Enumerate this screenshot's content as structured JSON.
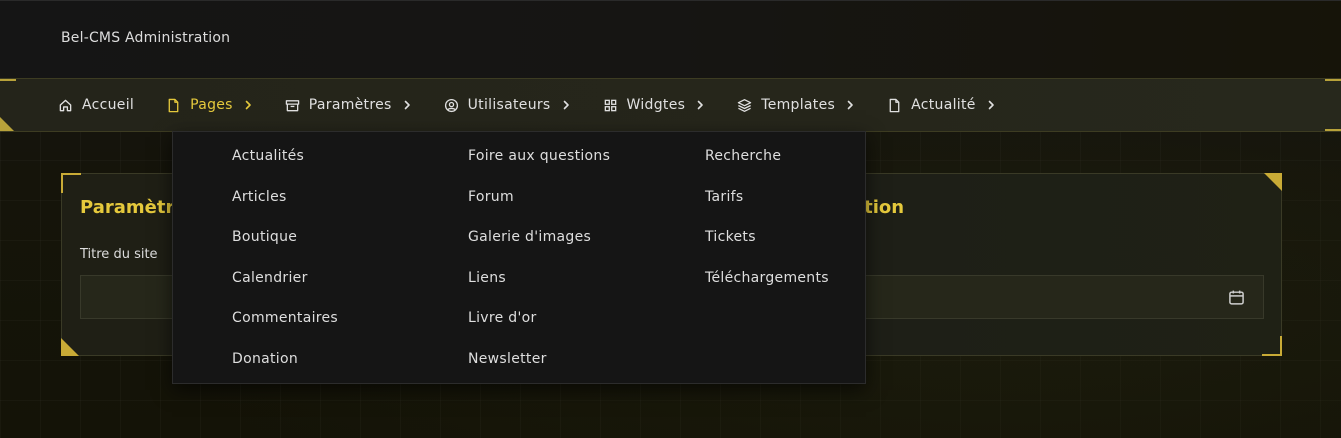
{
  "header": {
    "brand": "Bel-CMS Administration"
  },
  "nav": {
    "items": [
      {
        "label": "Accueil",
        "icon": "home-icon",
        "has_submenu": false,
        "active": false
      },
      {
        "label": "Pages",
        "icon": "file-icon",
        "has_submenu": true,
        "active": true
      },
      {
        "label": "Paramètres",
        "icon": "archive-icon",
        "has_submenu": true,
        "active": false
      },
      {
        "label": "Utilisateurs",
        "icon": "users-icon",
        "has_submenu": true,
        "active": false
      },
      {
        "label": "Widgtes",
        "icon": "grid-icon",
        "has_submenu": true,
        "active": false
      },
      {
        "label": "Templates",
        "icon": "layers-icon",
        "has_submenu": true,
        "active": false
      },
      {
        "label": "Actualité",
        "icon": "file-icon",
        "has_submenu": true,
        "active": false
      }
    ]
  },
  "dropdown": {
    "columns": [
      [
        "Actualités",
        "Articles",
        "Boutique",
        "Calendrier",
        "Commentaires",
        "Donation"
      ],
      [
        "Foire aux questions",
        "Forum",
        "Galerie d'images",
        "Liens",
        "Livre d'or",
        "Newsletter"
      ],
      [
        "Recherche",
        "Tarifs",
        "Tickets",
        "Téléchargements"
      ]
    ]
  },
  "card": {
    "title_left": "Paramètre",
    "title_right": "ation",
    "field_label": "Titre du site",
    "field_value": ""
  },
  "colors": {
    "accent": "#e5c93c",
    "corner": "#c9ab36",
    "text": "#e0e0e0",
    "dropdown_bg": "#151515"
  }
}
